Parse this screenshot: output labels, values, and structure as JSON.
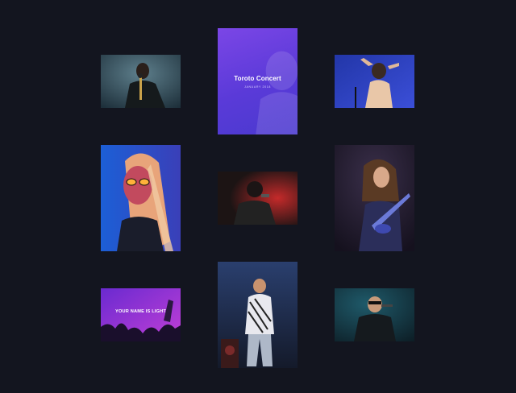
{
  "gallery": {
    "featured": {
      "title": "Toroto Concert",
      "date": "JANUARY 2018",
      "gradient_start": "#7b46e6",
      "gradient_end": "#4a39cf"
    },
    "crowd_banner_text": "YOUR NAME IS LIGHT",
    "background_color": "#13151f"
  }
}
